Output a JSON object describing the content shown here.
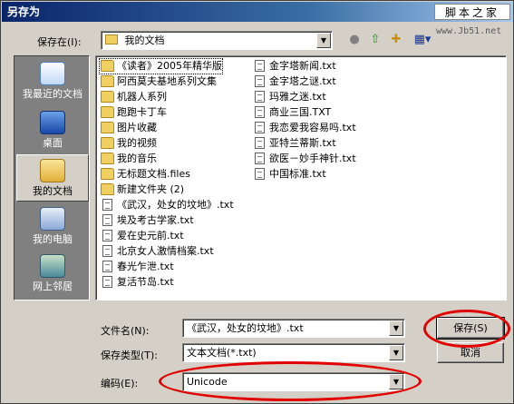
{
  "window": {
    "title": "另存为"
  },
  "watermark": {
    "brand": "脚本之家",
    "url": "www.Jb51.net"
  },
  "toolbar": {
    "save_in_label": "保存在(I):",
    "save_in_value": "我的文档",
    "buttons": [
      {
        "name": "back",
        "icon": "back-arrow-icon",
        "glyph": "◀"
      },
      {
        "name": "up",
        "icon": "up-folder-icon",
        "glyph": "⇧"
      },
      {
        "name": "new-folder",
        "icon": "new-folder-icon",
        "glyph": "✚"
      },
      {
        "name": "view-menu",
        "icon": "view-menu-icon",
        "glyph": "▦"
      }
    ]
  },
  "places": [
    {
      "label": "我最近的文档",
      "icon": "recent-documents-icon",
      "active": false
    },
    {
      "label": "桌面",
      "icon": "desktop-icon",
      "active": false
    },
    {
      "label": "我的文档",
      "icon": "my-documents-icon",
      "active": true
    },
    {
      "label": "我的电脑",
      "icon": "my-computer-icon",
      "active": false
    },
    {
      "label": "网上邻居",
      "icon": "network-places-icon",
      "active": false
    }
  ],
  "files_col1": [
    {
      "name": "《读者》2005年精华版",
      "type": "folder"
    },
    {
      "name": "阿西莫夫基地系列文集",
      "type": "folder"
    },
    {
      "name": "机器人系列",
      "type": "folder"
    },
    {
      "name": "跑跑卡丁车",
      "type": "folder"
    },
    {
      "name": "图片收藏",
      "type": "folder"
    },
    {
      "name": "我的视频",
      "type": "folder"
    },
    {
      "name": "我的音乐",
      "type": "folder"
    },
    {
      "name": "无标题文档.files",
      "type": "folder"
    },
    {
      "name": "新建文件夹 (2)",
      "type": "folder"
    },
    {
      "name": "《武汉，处女的坟地》.txt",
      "type": "text"
    },
    {
      "name": "埃及考古学家.txt",
      "type": "text"
    },
    {
      "name": "爱在史元前.txt",
      "type": "text"
    },
    {
      "name": "北京女人激情档案.txt",
      "type": "text"
    },
    {
      "name": "春光乍泄.txt",
      "type": "text"
    },
    {
      "name": "复活节岛.txt",
      "type": "text"
    }
  ],
  "files_col2": [
    {
      "name": "金字塔新闻.txt",
      "type": "text"
    },
    {
      "name": "金字塔之谜.txt",
      "type": "text"
    },
    {
      "name": "玛雅之迷.txt",
      "type": "text"
    },
    {
      "name": "商业三国.TXT",
      "type": "text"
    },
    {
      "name": "我恋爱我容易吗.txt",
      "type": "text"
    },
    {
      "name": "亚特兰蒂斯.txt",
      "type": "text"
    },
    {
      "name": "欲医－妙手神针.txt",
      "type": "text"
    },
    {
      "name": "中国标准.txt",
      "type": "text"
    }
  ],
  "form": {
    "filename_label": "文件名(N):",
    "filename_value": "《武汉，处女的坟地》.txt",
    "filetype_label": "保存类型(T):",
    "filetype_value": "文本文档(*.txt)",
    "encoding_label": "编码(E):",
    "encoding_value": "Unicode"
  },
  "buttons": {
    "save": "保存(S)",
    "cancel": "取消"
  },
  "colors": {
    "titlebar": "#0a246a",
    "highlight": "#e00000",
    "face": "#d4d0c8"
  }
}
